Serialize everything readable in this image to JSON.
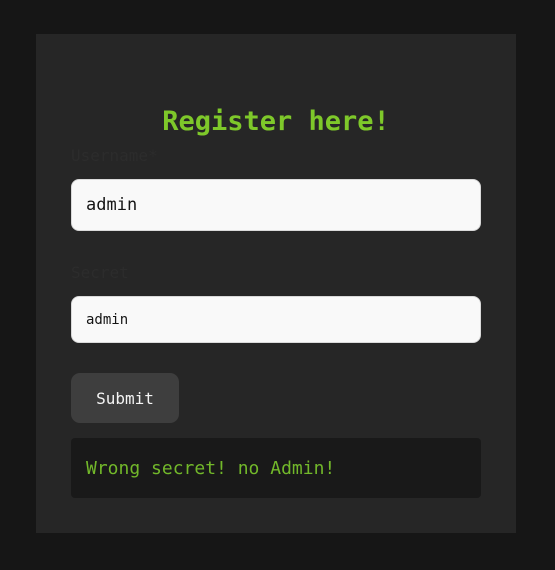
{
  "form": {
    "title": "Register here!",
    "username_label": "Username*",
    "username_value": "admin",
    "secret_label": "Secret",
    "secret_value": "admin",
    "submit_label": "Submit",
    "message": "Wrong secret! no Admin!"
  },
  "colors": {
    "page_background": "#161616",
    "card_background": "#262626",
    "accent_green": "#7ec82a",
    "message_background": "#191919",
    "button_background": "#3e3e3e"
  }
}
